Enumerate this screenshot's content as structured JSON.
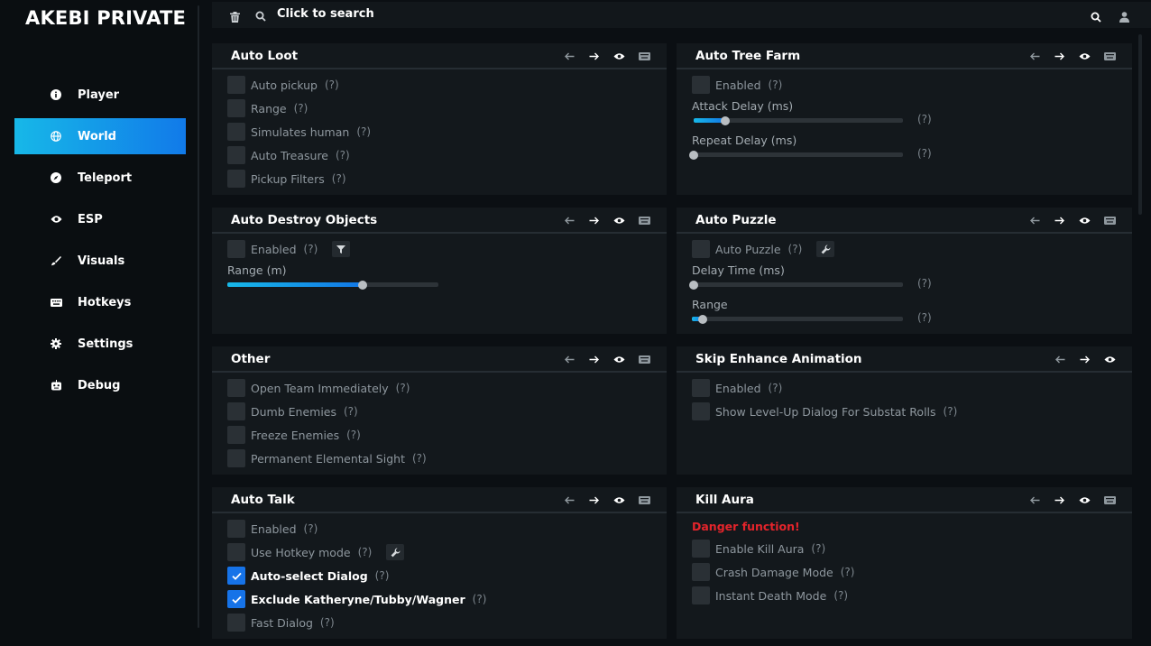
{
  "app": {
    "brand": "AKEBI PRIVATE"
  },
  "sidebar": {
    "items": [
      {
        "label": "Player",
        "icon": "info-icon",
        "active": false
      },
      {
        "label": "World",
        "icon": "globe-icon",
        "active": true
      },
      {
        "label": "Teleport",
        "icon": "compass-icon",
        "active": false
      },
      {
        "label": "ESP",
        "icon": "eye-icon",
        "active": false
      },
      {
        "label": "Visuals",
        "icon": "brush-icon",
        "active": false
      },
      {
        "label": "Hotkeys",
        "icon": "keyboard-icon",
        "active": false
      },
      {
        "label": "Settings",
        "icon": "gear-icon",
        "active": false
      },
      {
        "label": "Debug",
        "icon": "robot-icon",
        "active": false
      }
    ]
  },
  "search": {
    "placeholder": "Click to search"
  },
  "colors": {
    "accent_start": "#17b8e8",
    "accent_end": "#117ae9",
    "checkbox_checked": "#1673e8",
    "danger": "#e5242b"
  },
  "panels": {
    "auto_loot": {
      "title": "Auto Loot",
      "items": [
        {
          "label": "Auto pickup",
          "hint": "(?)",
          "checked": false
        },
        {
          "label": "Range",
          "hint": "(?)",
          "checked": false
        },
        {
          "label": "Simulates human",
          "hint": "(?)",
          "checked": false
        },
        {
          "label": "Auto Treasure",
          "hint": "(?)",
          "checked": false
        },
        {
          "label": "Pickup Filters",
          "hint": "(?)",
          "checked": false
        }
      ]
    },
    "auto_tree_farm": {
      "title": "Auto Tree Farm",
      "enabled": {
        "label": "Enabled",
        "hint": "(?)",
        "checked": false
      },
      "attack_delay": {
        "label": "Attack Delay (ms)",
        "hint": "(?)",
        "fraction": 0.15
      },
      "repeat_delay": {
        "label": "Repeat Delay (ms)",
        "hint": "(?)",
        "fraction": 0.0
      }
    },
    "auto_destroy": {
      "title": "Auto Destroy Objects",
      "enabled": {
        "label": "Enabled",
        "hint": "(?)",
        "checked": false
      },
      "range": {
        "label": "Range (m)",
        "fraction": 0.64
      }
    },
    "auto_puzzle": {
      "title": "Auto Puzzle",
      "toggle": {
        "label": "Auto Puzzle",
        "hint": "(?)",
        "checked": false
      },
      "delay": {
        "label": "Delay Time (ms)",
        "hint": "(?)",
        "fraction": 0.0
      },
      "range": {
        "label": "Range",
        "hint": "(?)",
        "fraction": 0.05
      }
    },
    "other": {
      "title": "Other",
      "items": [
        {
          "label": "Open Team Immediately",
          "hint": "(?)",
          "checked": false
        },
        {
          "label": "Dumb Enemies",
          "hint": "(?)",
          "checked": false
        },
        {
          "label": "Freeze Enemies",
          "hint": "(?)",
          "checked": false
        },
        {
          "label": "Permanent Elemental Sight",
          "hint": "(?)",
          "checked": false
        }
      ]
    },
    "skip_enhance": {
      "title": "Skip Enhance Animation",
      "items": [
        {
          "label": "Enabled",
          "hint": "(?)",
          "checked": false
        },
        {
          "label": "Show Level-Up Dialog For Substat Rolls",
          "hint": "(?)",
          "checked": false
        }
      ]
    },
    "auto_talk": {
      "title": "Auto Talk",
      "items": [
        {
          "label": "Enabled",
          "hint": "(?)",
          "checked": false
        },
        {
          "label": "Use Hotkey mode",
          "hint": "(?)",
          "checked": false
        },
        {
          "label": "Auto-select Dialog",
          "hint": "(?)",
          "checked": true
        },
        {
          "label": "Exclude Katheryne/Tubby/Wagner",
          "hint": "(?)",
          "checked": true
        },
        {
          "label": "Fast Dialog",
          "hint": "(?)",
          "checked": false
        }
      ]
    },
    "kill_aura": {
      "title": "Kill Aura",
      "danger": "Danger function!",
      "items": [
        {
          "label": "Enable Kill Aura",
          "hint": "(?)",
          "checked": false
        },
        {
          "label": "Crash Damage Mode",
          "hint": "(?)",
          "checked": false
        },
        {
          "label": "Instant Death Mode",
          "hint": "(?)",
          "checked": false
        }
      ]
    }
  }
}
